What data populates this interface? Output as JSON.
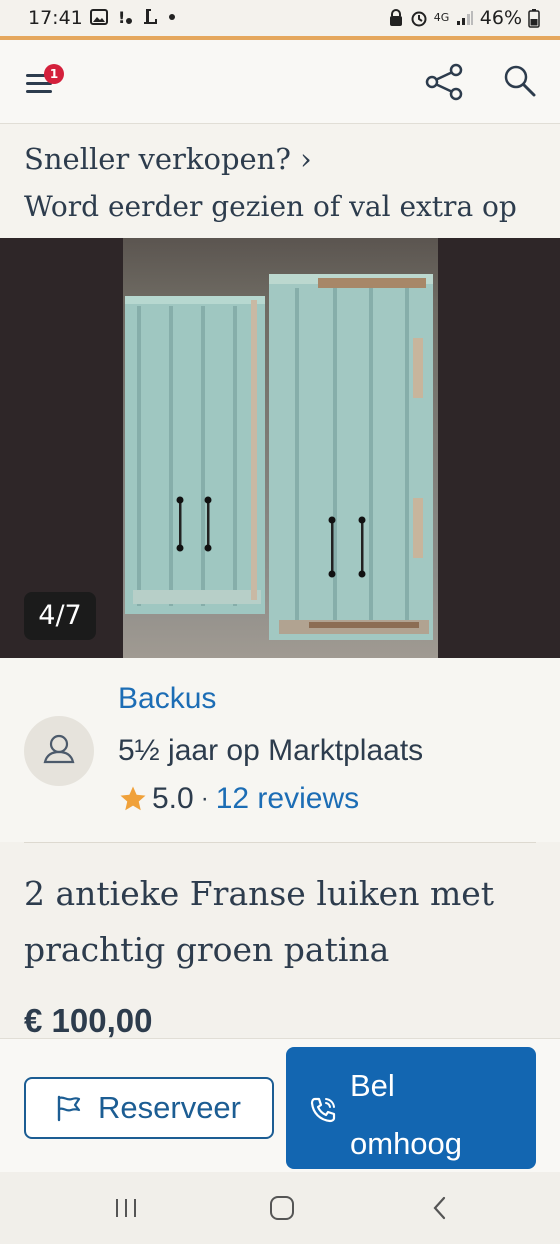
{
  "status_bar": {
    "time": "17:41",
    "network": "4G",
    "battery": "46%"
  },
  "header": {
    "menu_badge_count": "1",
    "icons": [
      "menu-icon",
      "share-icon",
      "search-icon"
    ]
  },
  "promo": {
    "headline": "Sneller verkopen?",
    "chevron": "›",
    "subline": "Word eerder gezien of val extra op"
  },
  "gallery": {
    "counter": "4/7"
  },
  "seller": {
    "name": "Backus",
    "membership": "5½ jaar op Marktplaats",
    "rating": "5.0",
    "separator": "·",
    "reviews": "12 reviews"
  },
  "listing": {
    "title": "2 antieke Franse luiken met prachtig groen patina",
    "price": "€ 100,00"
  },
  "actions": {
    "reserve_label": "Reserveer",
    "call_label": "Bel omhoog"
  },
  "colors": {
    "accent_orange": "#e5a75d",
    "link_blue": "#1c6db5",
    "primary_button": "#1366b1",
    "badge_red": "#d4203b",
    "text_dark": "#2d3c4d"
  }
}
